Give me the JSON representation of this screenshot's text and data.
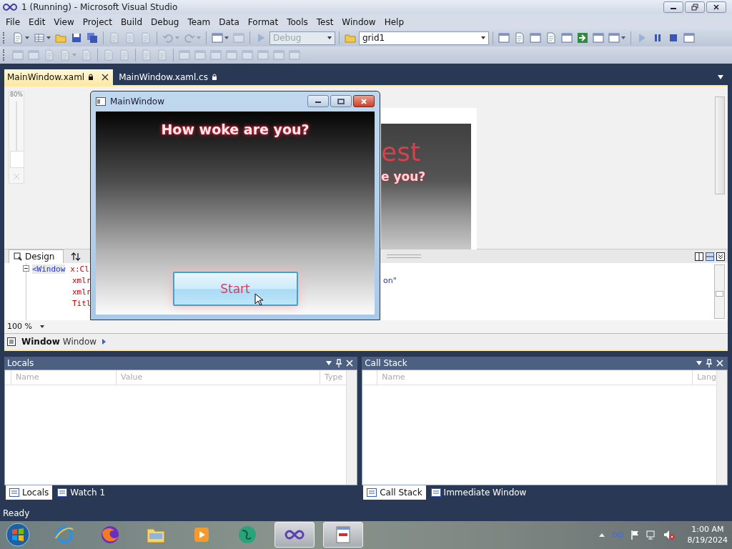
{
  "window": {
    "title": "1 (Running) - Microsoft Visual Studio"
  },
  "menu": [
    "File",
    "Edit",
    "View",
    "Project",
    "Build",
    "Debug",
    "Team",
    "Data",
    "Format",
    "Tools",
    "Test",
    "Window",
    "Help"
  ],
  "toolbar_rows": [
    [
      {
        "kind": "split-button",
        "disabled": false
      },
      {
        "kind": "split-button",
        "disabled": false
      },
      {
        "kind": "button",
        "disabled": false
      },
      {
        "kind": "button",
        "disabled": false
      },
      {
        "kind": "button",
        "disabled": false
      },
      {
        "kind": "separator"
      },
      {
        "kind": "button",
        "disabled": true
      },
      {
        "kind": "button",
        "disabled": true
      },
      {
        "kind": "button",
        "disabled": true
      },
      {
        "kind": "separator"
      },
      {
        "kind": "split-button",
        "disabled": true
      },
      {
        "kind": "split-button",
        "disabled": true
      },
      {
        "kind": "separator"
      },
      {
        "kind": "split-button",
        "disabled": false
      },
      {
        "kind": "button",
        "disabled": true
      },
      {
        "kind": "separator"
      },
      {
        "kind": "button",
        "disabled": true
      },
      {
        "kind": "combo",
        "value": "Debug",
        "disabled": true
      },
      {
        "kind": "separator"
      },
      {
        "kind": "button",
        "disabled": false
      },
      {
        "kind": "combo",
        "value": "grid1",
        "disabled": false
      },
      {
        "kind": "separator"
      },
      {
        "kind": "button",
        "disabled": false
      },
      {
        "kind": "button",
        "disabled": false
      },
      {
        "kind": "button",
        "disabled": false
      },
      {
        "kind": "button",
        "disabled": false
      },
      {
        "kind": "button",
        "disabled": false
      },
      {
        "kind": "button",
        "disabled": false
      },
      {
        "kind": "button",
        "disabled": false
      },
      {
        "kind": "split-button",
        "disabled": false
      },
      {
        "kind": "separator"
      },
      {
        "kind": "button",
        "disabled": true
      },
      {
        "kind": "button",
        "disabled": false
      },
      {
        "kind": "button",
        "disabled": false
      },
      {
        "kind": "button",
        "disabled": false
      }
    ],
    [
      {
        "kind": "button",
        "disabled": true
      },
      {
        "kind": "button",
        "disabled": true
      },
      {
        "kind": "button",
        "disabled": true
      },
      {
        "kind": "split-button",
        "disabled": true
      },
      {
        "kind": "button",
        "disabled": true
      },
      {
        "kind": "separator"
      },
      {
        "kind": "button",
        "disabled": true
      },
      {
        "kind": "button",
        "disabled": true
      },
      {
        "kind": "separator"
      },
      {
        "kind": "button",
        "disabled": true
      },
      {
        "kind": "button",
        "disabled": true
      },
      {
        "kind": "separator"
      },
      {
        "kind": "button",
        "disabled": true
      },
      {
        "kind": "button",
        "disabled": true
      },
      {
        "kind": "button",
        "disabled": true
      },
      {
        "kind": "button",
        "disabled": true
      },
      {
        "kind": "button",
        "disabled": true
      },
      {
        "kind": "button",
        "disabled": true
      },
      {
        "kind": "button",
        "disabled": true
      },
      {
        "kind": "button",
        "disabled": true
      }
    ]
  ],
  "doc_tabs": [
    {
      "label": "MainWindow.xaml",
      "selected": true
    },
    {
      "label": "MainWindow.xaml.cs",
      "selected": false
    }
  ],
  "designer": {
    "zoom_label": "80%",
    "zoom_slider": {
      "level": 0.25
    },
    "preview_title": "est",
    "preview_subtitle": "e you?"
  },
  "split_tabs": [
    {
      "label": "Design",
      "selected": true
    }
  ],
  "code_lines": [
    {
      "tag": "<Window",
      "text": "x:Cl"
    },
    {
      "text": "xmlr",
      "tail": "on\""
    },
    {
      "text": "xmlr"
    },
    {
      "text": "Titl"
    }
  ],
  "code_zoom": "100 %",
  "breadcrumb": {
    "bold": "Window",
    "text": "Window"
  },
  "app_window": {
    "title": "MainWindow",
    "heading": "How woke are you?",
    "button": "Start"
  },
  "panels": [
    {
      "title": "Locals",
      "columns": [
        "Name",
        "Value",
        "Type"
      ],
      "tabs": [
        {
          "label": "Locals",
          "selected": true
        },
        {
          "label": "Watch 1",
          "selected": false
        }
      ]
    },
    {
      "title": "Call Stack",
      "columns": [
        "Name",
        "Lang"
      ],
      "tabs": [
        {
          "label": "Call Stack",
          "selected": true
        },
        {
          "label": "Immediate Window",
          "selected": false
        }
      ]
    }
  ],
  "status_bar": "Ready",
  "taskbar": {
    "apps": [
      {
        "active": false
      },
      {
        "active": false
      },
      {
        "active": false
      },
      {
        "active": false
      },
      {
        "active": false
      },
      {
        "active": true
      },
      {
        "active": true
      }
    ],
    "time": "1:00 AM",
    "date": "8/19/2024"
  }
}
